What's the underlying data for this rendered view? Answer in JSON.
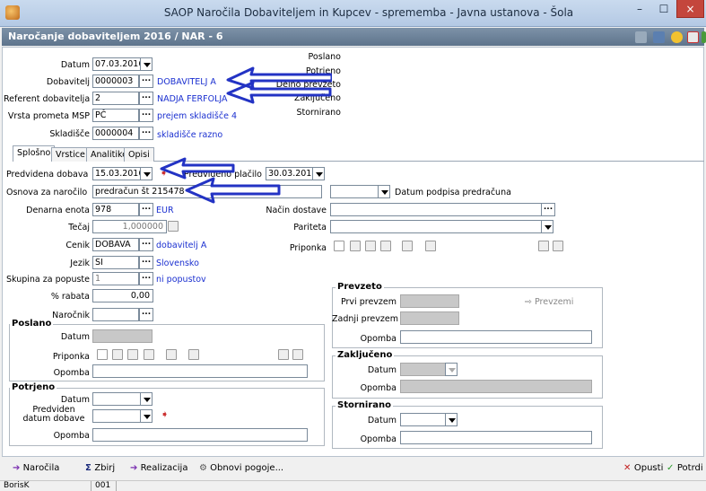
{
  "window": {
    "title": "SAOP  Naročila Dobaviteljem in Kupcev - sprememba - Javna ustanova - Šola",
    "minimize": "–",
    "maximize": "☐",
    "close": "×"
  },
  "subheader": {
    "title": "Naročanje dobaviteljem 2016 / NAR - 6"
  },
  "header_form": {
    "datum_label": "Datum",
    "datum_value": "07.03.2016",
    "dobavitelj_label": "Dobavitelj",
    "dobavitelj_value": "0000003",
    "dobavitelj_name": "DOBAVITELJ  A",
    "referent_label": "Referent dobavitelja",
    "referent_value": "2",
    "referent_name": "NADJA FERFOLJA",
    "vrsta_label": "Vrsta prometa MSP",
    "vrsta_value": "PČ",
    "vrsta_name": "prejem skladišče 4",
    "skladisce_label": "Skladišče",
    "skladisce_value": "0000004",
    "skladisce_name": "skladišče razno"
  },
  "status_list": [
    "Poslano",
    "Potrjeno",
    "Delno prevzeto",
    "Zaključeno",
    "Stornirano"
  ],
  "tabs": [
    "Splošno",
    "Vrstice",
    "Analitike",
    "Opisi"
  ],
  "splosno": {
    "predvidena_dobava_label": "Predvidena dobava",
    "predvidena_dobava_value": "15.03.2016",
    "predvideno_placilo_label": "Predvideno plačilo",
    "predvideno_placilo_value": "30.03.2016",
    "osnova_label": "Osnova za naročilo",
    "osnova_value": "predračun št 215478",
    "datum_podpisa_label": "Datum podpisa predračuna",
    "denarna_enota_label": "Denarna enota",
    "denarna_enota_value": "978",
    "denarna_enota_name": "EUR",
    "tecaj_label": "Tečaj",
    "tecaj_value": "1,000000",
    "cenik_label": "Cenik",
    "cenik_value": "DOBAVA",
    "cenik_name": "dobavitelj A",
    "jezik_label": "Jezik",
    "jezik_value": "SI",
    "jezik_name": "Slovensko",
    "skupina_label": "Skupina za popuste",
    "skupina_value": "1",
    "skupina_name": "ni popustov",
    "rabat_label": "% rabata",
    "rabat_value": "0,00",
    "narocnik_label": "Naročnik",
    "nacin_dostave_label": "Način dostave",
    "pariteta_label": "Pariteta",
    "priponka_label": "Priponka"
  },
  "poslano": {
    "title": "Poslano",
    "datum_label": "Datum",
    "priponka_label": "Priponka",
    "opomba_label": "Opomba"
  },
  "potrjeno": {
    "title": "Potrjeno",
    "datum_label": "Datum",
    "predviden_label": "Predviden datum dobave",
    "opomba_label": "Opomba"
  },
  "prevzeto": {
    "title": "Prevzeto",
    "prvi_label": "Prvi prevzem",
    "zadnji_label": "Zadnji prevzem",
    "opomba_label": "Opomba",
    "prevzemi_button": "Prevzemi"
  },
  "zakljuceno": {
    "title": "Zaključeno",
    "datum_label": "Datum",
    "opomba_label": "Opomba"
  },
  "stornirano": {
    "title": "Stornirano",
    "datum_label": "Datum",
    "opomba_label": "Opomba"
  },
  "toolbar": {
    "narocila": "Naročila",
    "zbirj": "Zbirj",
    "realizacija": "Realizacija",
    "obnovi": "Obnovi pogoje...",
    "opusti": "Opusti",
    "potrdi": "Potrdi"
  },
  "statusbar": {
    "user": "BorisK",
    "code": "001"
  },
  "colors": {
    "annotation_arrow": "#2333c4",
    "link": "#1a2fd0",
    "header": "#6a7f96"
  }
}
